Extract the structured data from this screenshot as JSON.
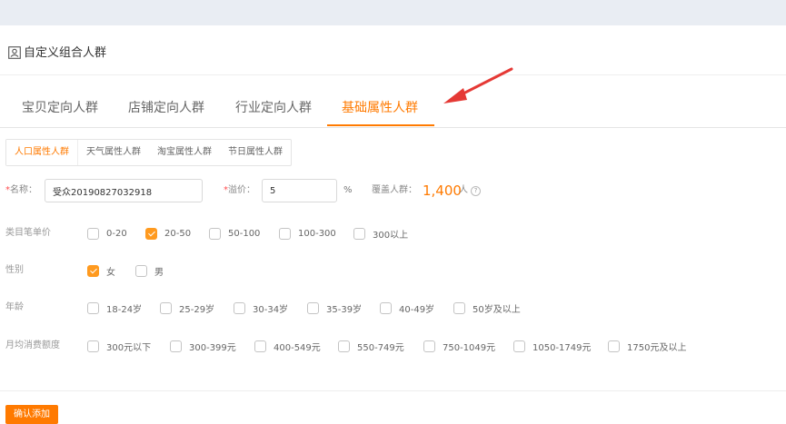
{
  "header": {
    "title": "自定义组合人群",
    "icon": "user-group-icon"
  },
  "tabs": [
    {
      "label": "宝贝定向人群",
      "active": false
    },
    {
      "label": "店铺定向人群",
      "active": false
    },
    {
      "label": "行业定向人群",
      "active": false
    },
    {
      "label": "基础属性人群",
      "active": true
    }
  ],
  "subtabs": [
    {
      "label": "人口属性人群",
      "active": true
    },
    {
      "label": "天气属性人群",
      "active": false
    },
    {
      "label": "淘宝属性人群",
      "active": false
    },
    {
      "label": "节日属性人群",
      "active": false
    }
  ],
  "form": {
    "name_required_mark": "*",
    "name_label": "名称：",
    "name_value": "受众20190827032918",
    "premium_required_mark": "*",
    "premium_label": "溢价：",
    "premium_value": "5",
    "premium_unit": "%",
    "coverage_label": "覆盖人群：",
    "coverage_value": "1,400",
    "coverage_unit": "人",
    "help_glyph": "?"
  },
  "filters": [
    {
      "label": "类目笔单价",
      "options": [
        {
          "text": "0-20",
          "checked": false
        },
        {
          "text": "20-50",
          "checked": true
        },
        {
          "text": "50-100",
          "checked": false
        },
        {
          "text": "100-300",
          "checked": false
        },
        {
          "text": "300以上",
          "checked": false
        }
      ]
    },
    {
      "label": "性别",
      "options": [
        {
          "text": "女",
          "checked": true
        },
        {
          "text": "男",
          "checked": false
        }
      ]
    },
    {
      "label": "年龄",
      "options": [
        {
          "text": "18-24岁",
          "checked": false
        },
        {
          "text": "25-29岁",
          "checked": false
        },
        {
          "text": "30-34岁",
          "checked": false
        },
        {
          "text": "35-39岁",
          "checked": false
        },
        {
          "text": "40-49岁",
          "checked": false
        },
        {
          "text": "50岁及以上",
          "checked": false
        }
      ]
    },
    {
      "label": "月均消费额度",
      "options": [
        {
          "text": "300元以下",
          "checked": false
        },
        {
          "text": "300-399元",
          "checked": false
        },
        {
          "text": "400-549元",
          "checked": false
        },
        {
          "text": "550-749元",
          "checked": false
        },
        {
          "text": "750-1049元",
          "checked": false
        },
        {
          "text": "1050-1749元",
          "checked": false
        },
        {
          "text": "1750元及以上",
          "checked": false
        }
      ]
    }
  ],
  "actions": {
    "confirm_label": "确认添加"
  },
  "annotation": {
    "arrow_color": "#e53935"
  },
  "colors": {
    "accent": "#ff7a00",
    "checkbox_checked": "#ff9a1f",
    "required": "#ff4d4f"
  }
}
